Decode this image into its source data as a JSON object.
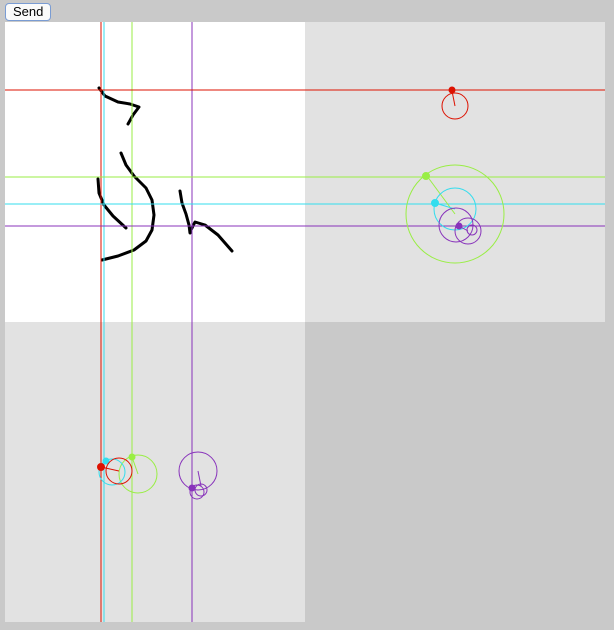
{
  "toolbar": {
    "send_label": "Send"
  },
  "colors": {
    "red": "#dd1100",
    "cyan": "#33ddee",
    "green": "#99ee44",
    "purple": "#8833bb",
    "ink": "#000000",
    "panel_white": "#ffffff",
    "panel_gray": "#e2e2e2",
    "background": "#c9c9c9"
  },
  "icons": [
    "red-epicycle-icon",
    "green-epicycle-icon",
    "cyan-epicycle-icon",
    "purple-epicycle-icon"
  ]
}
